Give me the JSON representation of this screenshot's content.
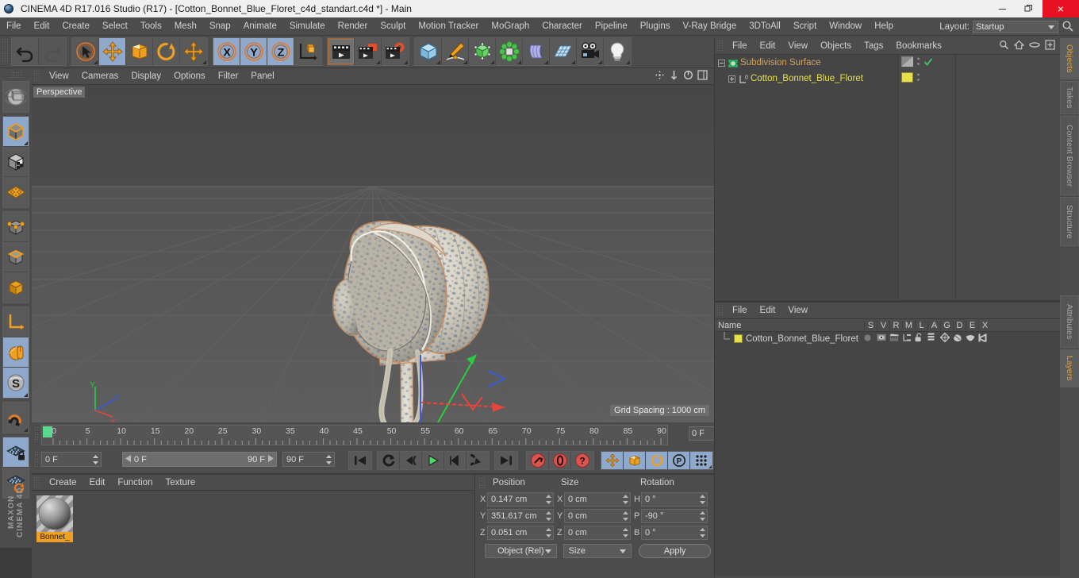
{
  "titlebar": {
    "app_icon": "c4d-logo-icon",
    "title": "CINEMA 4D R17.016 Studio (R17) - [Cotton_Bonnet_Blue_Floret_c4d_standart.c4d *] - Main",
    "minimize": "minimize-icon",
    "restore": "restore-icon",
    "close": "×"
  },
  "menubar": {
    "items": [
      "File",
      "Edit",
      "Create",
      "Select",
      "Tools",
      "Mesh",
      "Snap",
      "Animate",
      "Simulate",
      "Render",
      "Sculpt",
      "Motion Tracker",
      "MoGraph",
      "Character",
      "Pipeline",
      "Plugins",
      "V-Ray Bridge",
      "3DToAll",
      "Script",
      "Window",
      "Help"
    ],
    "layout_label": "Layout:",
    "layout_value": "Startup",
    "search_icon": "search-icon"
  },
  "toolbar": {
    "groups": [
      {
        "name": "history",
        "buttons": [
          {
            "icon": "undo-icon",
            "state": "normal"
          },
          {
            "icon": "redo-icon",
            "state": "disabled"
          }
        ]
      },
      {
        "name": "transform",
        "buttons": [
          {
            "icon": "select-live-icon",
            "state": "normal",
            "corner": true
          },
          {
            "icon": "move-icon",
            "state": "selected"
          },
          {
            "icon": "scale-icon",
            "state": "normal"
          },
          {
            "icon": "rotate-icon",
            "state": "normal"
          },
          {
            "icon": "move-alt-icon",
            "state": "normal",
            "corner": true
          }
        ]
      },
      {
        "name": "axis-locks",
        "buttons": [
          {
            "icon": "x-axis-icon",
            "state": "selected"
          },
          {
            "icon": "y-axis-icon",
            "state": "selected"
          },
          {
            "icon": "z-axis-icon",
            "state": "selected"
          },
          {
            "icon": "world-object-coord-icon",
            "state": "normal"
          }
        ]
      },
      {
        "name": "render",
        "buttons": [
          {
            "icon": "render-view-icon",
            "state": "normal"
          },
          {
            "icon": "render-to-picture-viewer-icon",
            "state": "normal",
            "corner": true
          },
          {
            "icon": "render-settings-icon",
            "state": "normal",
            "corner": true
          }
        ]
      },
      {
        "name": "create",
        "buttons": [
          {
            "icon": "cube-primitive-icon",
            "state": "normal",
            "corner": true
          },
          {
            "icon": "pen-spline-icon",
            "state": "normal",
            "corner": true
          },
          {
            "icon": "nurbs-generator-icon",
            "state": "normal",
            "corner": true
          },
          {
            "icon": "mograph-cloner-icon",
            "state": "normal",
            "corner": true
          },
          {
            "icon": "deformer-bend-icon",
            "state": "normal",
            "corner": true
          },
          {
            "icon": "floor-environment-icon",
            "state": "normal",
            "corner": true
          },
          {
            "icon": "camera-icon",
            "state": "normal",
            "corner": true
          },
          {
            "icon": "light-icon",
            "state": "normal",
            "corner": true
          }
        ]
      }
    ]
  },
  "lefttools": {
    "buttons": [
      {
        "icon": "world-axis-icon",
        "group": 0
      },
      {
        "icon": "model-mode-icon",
        "group": 1,
        "state": "selected",
        "corner": true
      },
      {
        "icon": "texture-mode-icon",
        "group": 1
      },
      {
        "icon": "workplane-icon",
        "group": 1
      },
      {
        "icon": "points-mode-icon",
        "group": 2
      },
      {
        "icon": "edges-mode-icon",
        "group": 2
      },
      {
        "icon": "polygons-mode-icon",
        "group": 2
      },
      {
        "icon": "axis-modify-icon",
        "group": 3
      },
      {
        "icon": "viewport-solo-mouse-icon",
        "group": 3,
        "state": "selected"
      },
      {
        "icon": "enable-axis-s-icon",
        "group": 3,
        "state": "selected",
        "corner": true
      },
      {
        "icon": "magnet-icon",
        "group": 4,
        "corner": true
      },
      {
        "icon": "lock-workplane-icon",
        "group": 5,
        "state": "selected"
      },
      {
        "icon": "planar-workplane-icon",
        "group": 5
      }
    ],
    "brand": "MAXON CINEMA 4D"
  },
  "viewport": {
    "menu": [
      "View",
      "Cameras",
      "Display",
      "Filter",
      "Options",
      "Panel"
    ],
    "menu_order": [
      "View",
      "Cameras",
      "Display",
      "Options",
      "Filter",
      "Panel"
    ],
    "header_icons": [
      "move-camera-icon",
      "zoom-camera-icon",
      "rotate-camera-icon",
      "panel-layout-icon"
    ],
    "label": "Perspective",
    "grid_spacing": "Grid Spacing : 1000 cm",
    "axis_gizmo": {
      "x": "X",
      "y": "Y",
      "z": "Z"
    },
    "scene_object": "Cotton bonnet on stand"
  },
  "timeline": {
    "ticks": [
      "0",
      "5",
      "10",
      "15",
      "20",
      "25",
      "30",
      "35",
      "40",
      "45",
      "50",
      "55",
      "60",
      "65",
      "70",
      "75",
      "80",
      "85",
      "90"
    ],
    "current_frame": "0 F"
  },
  "transport": {
    "start_field": "0 F",
    "range_start": "0 F",
    "range_end": "90 F",
    "end_field": "90 F",
    "buttons": [
      {
        "icon": "go-to-start-icon"
      },
      {
        "icon": "play-loop-icon"
      },
      {
        "icon": "step-back-icon"
      },
      {
        "icon": "play-forward-icon",
        "color": "#4cd964"
      },
      {
        "icon": "step-forward-icon"
      },
      {
        "icon": "loop-play-icon"
      },
      {
        "icon": "go-to-end-icon"
      },
      {
        "icon": "record-keyframe-icon",
        "color": "#d9534f"
      },
      {
        "icon": "autokeying-icon",
        "color": "#d9534f"
      },
      {
        "icon": "keyframe-selection-icon",
        "color": "#d9534f"
      },
      {
        "icon": "key-position-icon",
        "state": "selected"
      },
      {
        "icon": "key-scale-icon",
        "state": "selected"
      },
      {
        "icon": "key-rotation-icon",
        "state": "selected"
      },
      {
        "icon": "key-parameter-icon",
        "state": "selected"
      },
      {
        "icon": "key-pla-icon",
        "state": "selected"
      },
      {
        "icon": "timeline-toggle-icon"
      }
    ]
  },
  "material_manager": {
    "menu": [
      "Create",
      "Edit",
      "Function",
      "Texture"
    ],
    "materials": [
      {
        "name": "Bonnet_",
        "preview": "sphere-preview",
        "selected": true
      }
    ]
  },
  "coordinates": {
    "headers": [
      "Position",
      "Size",
      "Rotation"
    ],
    "rows": [
      {
        "plabel": "X",
        "pvalue": "0.147 cm",
        "slabel": "X",
        "svalue": "0 cm",
        "rlabel": "H",
        "rvalue": "0 °"
      },
      {
        "plabel": "Y",
        "pvalue": "351.617 cm",
        "slabel": "Y",
        "svalue": "0 cm",
        "rlabel": "P",
        "rvalue": "-90 °"
      },
      {
        "plabel": "Z",
        "pvalue": "0.051 cm",
        "slabel": "Z",
        "svalue": "0 cm",
        "rlabel": "B",
        "rvalue": "0 °"
      }
    ],
    "mode_dropdown": "Object (Rel)",
    "size_dropdown": "Size",
    "apply_button": "Apply"
  },
  "object_manager": {
    "menu": [
      "File",
      "Edit",
      "View",
      "Objects",
      "Tags",
      "Bookmarks"
    ],
    "header_icons": [
      "search-icon",
      "home-icon",
      "eye-icon",
      "add-layer-icon"
    ],
    "rows": [
      {
        "name": "Subdivision Surface",
        "icon": "subdivision-surface-icon",
        "depth": 0,
        "color": "#cfa35e",
        "enabled": true,
        "tag": "checkmark-green"
      },
      {
        "name": "Cotton_Bonnet_Blue_Floret",
        "icon": "polygon-object-icon",
        "depth": 1,
        "color": "#e8e04a",
        "enabled": true,
        "tag": "yellow-material-tag"
      }
    ]
  },
  "layer_manager": {
    "menu": [
      "File",
      "Edit",
      "View"
    ],
    "columns": [
      "Name",
      "S",
      "V",
      "R",
      "M",
      "L",
      "A",
      "G",
      "D",
      "E",
      "X"
    ],
    "rows": [
      {
        "name": "Cotton_Bonnet_Blue_Floret",
        "swatch": "#e8e04a",
        "icons": [
          "solo-dot-icon",
          "view-eye-icon",
          "render-clapper-icon",
          "manager-tree-icon",
          "lock-open-icon",
          "animation-bars-icon",
          "generator-icon",
          "deformer-icon",
          "expression-icon",
          "xref-icon"
        ]
      }
    ]
  },
  "vertical_tabs": {
    "top": [
      {
        "label": "Objects",
        "active": true
      },
      {
        "label": "Takes",
        "active": false
      },
      {
        "label": "Content Browser",
        "active": false
      },
      {
        "label": "Structure",
        "active": false
      }
    ],
    "bottom": [
      {
        "label": "Attributes",
        "active": false
      },
      {
        "label": "Layers",
        "active": true
      }
    ]
  },
  "colors": {
    "panel_bg": "#4c4c4c",
    "viewport_bg": "#555555",
    "accent_orange": "#f0a020",
    "selected_blue": "#8fa9cc",
    "close_red": "#e81123",
    "object_yellow": "#e8e04a",
    "subdivision_tan": "#cfa35e"
  }
}
